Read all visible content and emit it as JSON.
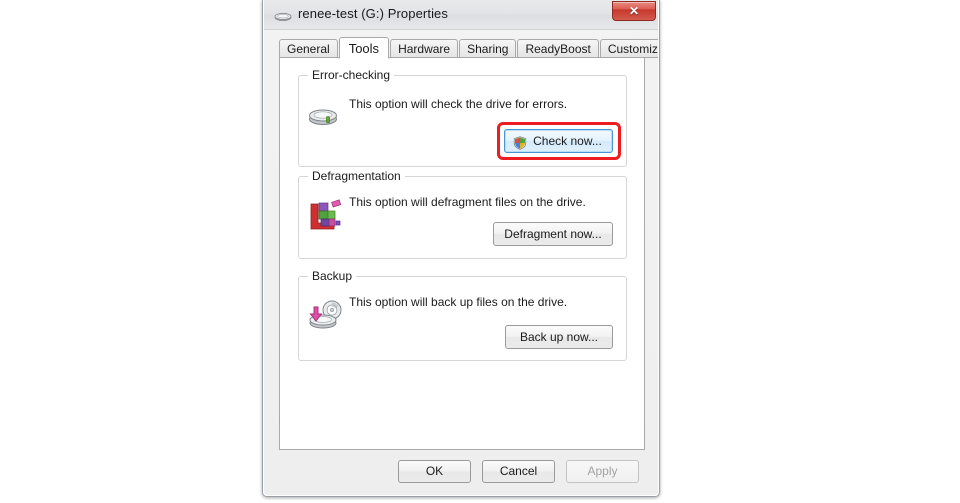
{
  "window": {
    "title": "renee-test (G:) Properties",
    "drive_icon": "hard-drive-icon",
    "close_label": "✕"
  },
  "tabs": [
    {
      "label": "General",
      "active": false
    },
    {
      "label": "Tools",
      "active": true
    },
    {
      "label": "Hardware",
      "active": false
    },
    {
      "label": "Sharing",
      "active": false
    },
    {
      "label": "ReadyBoost",
      "active": false
    },
    {
      "label": "Customize",
      "active": false
    }
  ],
  "groups": {
    "error_checking": {
      "title": "Error-checking",
      "description": "This option will check the drive for errors.",
      "icon": "hard-drive-icon",
      "button_label": "Check now...",
      "button_has_shield": true,
      "button_focused": true,
      "button_highlighted": true
    },
    "defragmentation": {
      "title": "Defragmentation",
      "description": "This option will defragment files on the drive.",
      "icon": "defragment-icon",
      "button_label": "Defragment now..."
    },
    "backup": {
      "title": "Backup",
      "description": "This option will back up files on the drive.",
      "icon": "backup-drive-icon",
      "button_label": "Back up now..."
    }
  },
  "footer": {
    "ok_label": "OK",
    "cancel_label": "Cancel",
    "apply_label": "Apply",
    "apply_disabled": true
  },
  "colors": {
    "annotation": "#ee1d22",
    "close_button": "#c6372c",
    "focus_border": "#4b94d6",
    "page_background": "#ffffff",
    "dialog_background": "#f0f0f0"
  }
}
